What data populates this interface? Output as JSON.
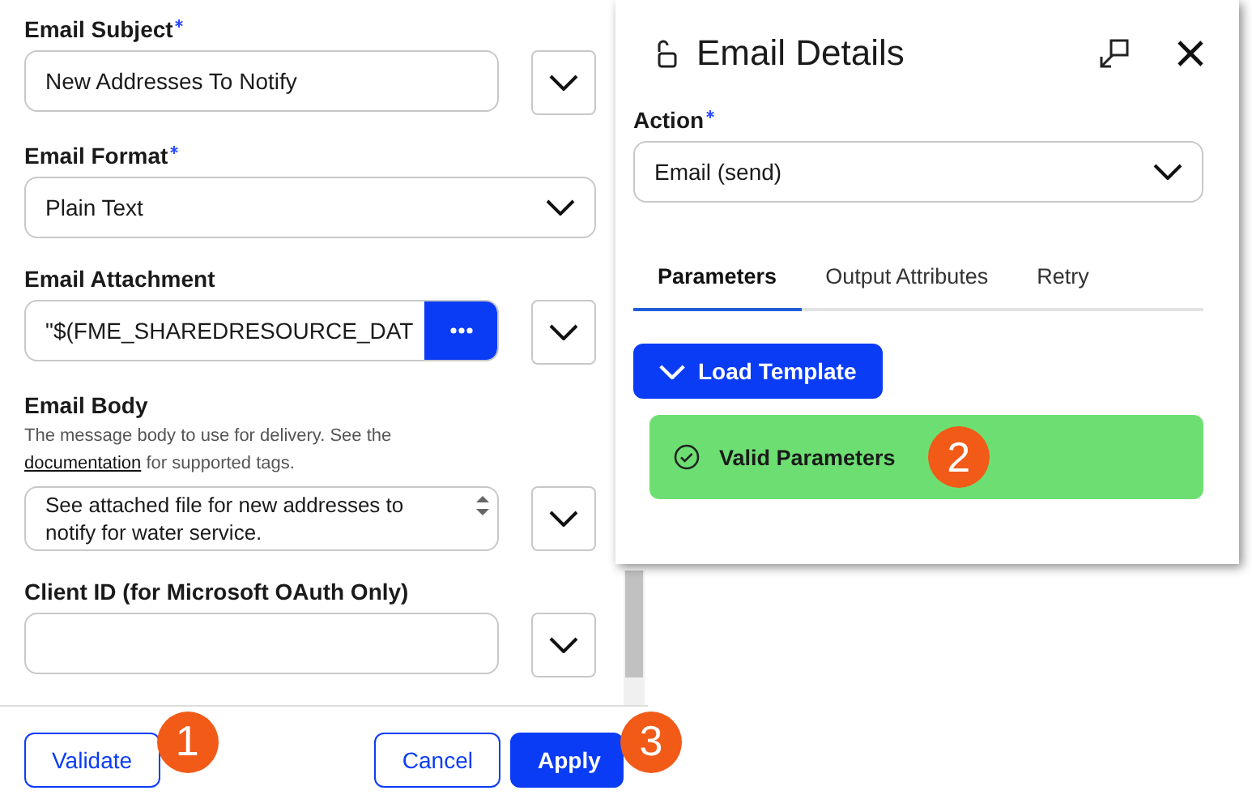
{
  "form": {
    "fields": [
      {
        "kind": "text",
        "label": "Email Subject",
        "required": true,
        "value": "New Addresses To Notify"
      },
      {
        "kind": "select",
        "label": "Email Format",
        "required": true,
        "value": "Plain Text"
      },
      {
        "kind": "file",
        "label": "Email Attachment",
        "required": false,
        "value": "\"$(FME_SHAREDRESOURCE_DAT"
      },
      {
        "kind": "textarea",
        "label": "Email Body",
        "required": false,
        "help": "The message body to use for delivery. See the",
        "help_link": "documentation",
        "help_tail": "for supported tags.",
        "value": "See attached file for new addresses to notify for water service."
      },
      {
        "kind": "text",
        "label": "Client ID (for Microsoft OAuth Only)",
        "required": false
      }
    ]
  },
  "footer": {
    "buttons": [
      {
        "label": "Validate",
        "kind": "outline",
        "callout": "1"
      },
      {
        "label": "Cancel",
        "kind": "outline"
      },
      {
        "label": "Apply",
        "kind": "primary",
        "callout": "3"
      }
    ]
  },
  "panel": {
    "title": "Email Details",
    "action": {
      "label": "Action",
      "required": true,
      "value": "Email (send)"
    },
    "tabs": [
      {
        "label": "Parameters",
        "selected": true
      },
      {
        "label": "Output Attributes",
        "selected": false
      },
      {
        "label": "Retry",
        "selected": false
      }
    ],
    "load_template": "Load Template",
    "status": {
      "text": "Valid Parameters",
      "callout": "2"
    }
  }
}
